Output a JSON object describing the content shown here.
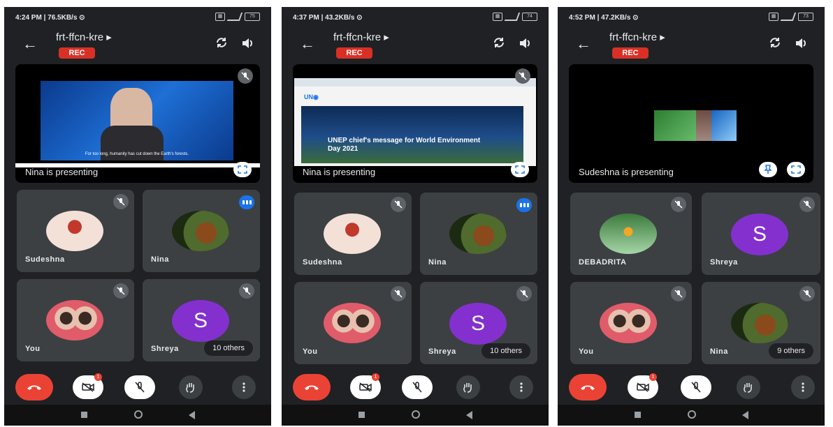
{
  "meeting_title": "frt-ffcn-kre ▸",
  "rec_label": "REC",
  "colors": {
    "end_call": "#ea4335",
    "rec": "#d93025",
    "avatar_s": "#8430ce",
    "speaking": "#1a73e8"
  },
  "icons": {
    "back": "arrow-left-icon",
    "switch": "camera-switch-icon",
    "volume": "speaker-icon",
    "mute": "mic-off-icon",
    "fullscreen": "fullscreen-icon",
    "pin": "pin-icon",
    "end": "phone-hangup-icon",
    "camera": "camera-off-icon",
    "mic": "mic-off-icon",
    "hand": "raise-hand-icon",
    "more": "more-vert-icon"
  },
  "screens": [
    {
      "status_time": "4:24 PM | 76.5KB/s ⊙",
      "battery": "75",
      "presenting": "Nina is presenting",
      "caption": "For too long, humanity has cut down the Earth's forests.",
      "tiles": [
        {
          "name": "Sudeshna"
        },
        {
          "name": "Nina"
        },
        {
          "name": "You"
        },
        {
          "name": "Shreya",
          "letter": "S"
        }
      ],
      "others": "10 others",
      "camera_badge": "1"
    },
    {
      "status_time": "4:37 PM | 43.2KB/s ⊙",
      "battery": "74",
      "presenting": "Nina is presenting",
      "slide_title": "UNEP chief's message for World Environment Day 2021",
      "tiles": [
        {
          "name": "Sudeshna"
        },
        {
          "name": "Nina"
        },
        {
          "name": "You"
        },
        {
          "name": "Shreya",
          "letter": "S"
        }
      ],
      "others": "10 others",
      "camera_badge": "1"
    },
    {
      "status_time": "4:52 PM | 47.2KB/s ⊙",
      "battery": "73",
      "presenting": "Sudeshna is presenting",
      "tiles": [
        {
          "name": "DEBADRITA"
        },
        {
          "name": "Shreya",
          "letter": "S"
        },
        {
          "name": "You"
        },
        {
          "name": "Nina"
        }
      ],
      "others": "9 others",
      "camera_badge": "1"
    }
  ]
}
